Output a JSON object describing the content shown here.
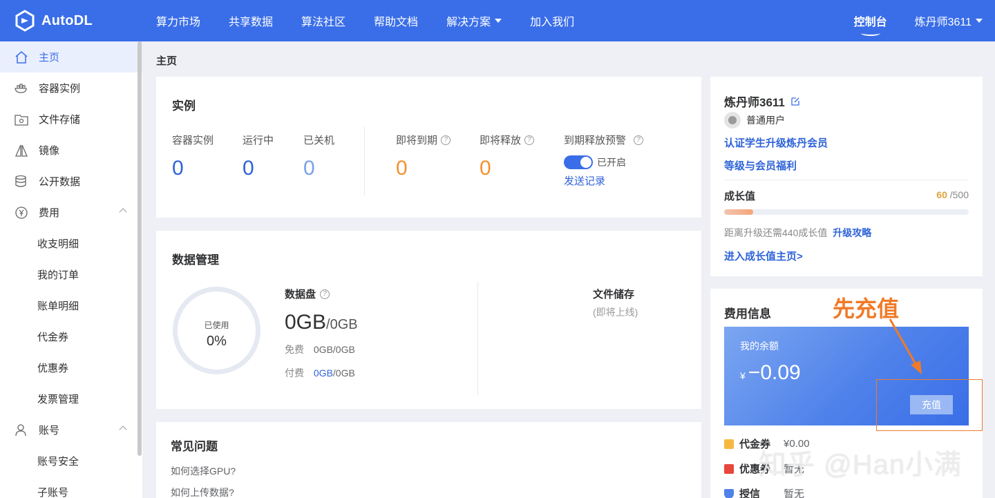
{
  "header": {
    "brand": "AutoDL",
    "nav": [
      {
        "label": "算力市场"
      },
      {
        "label": "共享数据"
      },
      {
        "label": "算法社区"
      },
      {
        "label": "帮助文档"
      },
      {
        "label": "解决方案",
        "dropdown": true
      },
      {
        "label": "加入我们"
      }
    ],
    "console": "控制台",
    "user": "炼丹师3611"
  },
  "sidebar": {
    "items": [
      {
        "label": "主页",
        "icon": "home-icon",
        "active": true
      },
      {
        "label": "容器实例",
        "icon": "container-icon"
      },
      {
        "label": "文件存储",
        "icon": "folder-icon"
      },
      {
        "label": "镜像",
        "icon": "image-icon"
      },
      {
        "label": "公开数据",
        "icon": "database-icon"
      },
      {
        "label": "费用",
        "icon": "yuan-icon",
        "expanded": true
      },
      {
        "label": "收支明细",
        "sub": true
      },
      {
        "label": "我的订单",
        "sub": true
      },
      {
        "label": "账单明细",
        "sub": true
      },
      {
        "label": "代金券",
        "sub": true
      },
      {
        "label": "优惠券",
        "sub": true
      },
      {
        "label": "发票管理",
        "sub": true
      },
      {
        "label": "账号",
        "icon": "user-icon",
        "expanded": true
      },
      {
        "label": "账号安全",
        "sub": true
      },
      {
        "label": "子账号",
        "sub": true
      }
    ]
  },
  "breadcrumb": "主页",
  "instances": {
    "title": "实例",
    "stats": [
      {
        "label": "容器实例",
        "value": "0",
        "color": "#2f63d8"
      },
      {
        "label": "运行中",
        "value": "0",
        "color": "#2f63d8"
      },
      {
        "label": "已关机",
        "value": "0",
        "color": "#7aa0e8"
      },
      {
        "label": "即将到期",
        "value": "0",
        "color": "#f5902f"
      },
      {
        "label": "即将释放",
        "value": "0",
        "color": "#f5902f"
      }
    ],
    "alert_label": "到期释放预警",
    "alert_state": "已开启",
    "send_log": "发送记录"
  },
  "data_mgmt": {
    "title": "数据管理",
    "ring_label": "已使用",
    "ring_value": "0%",
    "disk_label": "数据盘",
    "disk_used": "0GB",
    "disk_total": "/0GB",
    "free_label": "免费",
    "free_value": "0GB/0GB",
    "paid_label": "付费",
    "paid_used": "0GB",
    "paid_total": "/0GB",
    "file_title": "文件储存",
    "file_note": "(即将上线)"
  },
  "faq": {
    "title": "常见问题",
    "items": [
      "如何选择GPU?",
      "如何上传数据?"
    ]
  },
  "profile": {
    "name": "炼丹师3611",
    "level": "普通用户",
    "student_link": "认证学生升级炼丹会员",
    "benefits_link": "等级与会员福利",
    "growth_label": "成长值",
    "growth_value": "60",
    "growth_max": "/500",
    "growth_fraction": 0.12,
    "upgrade_note": "距离升级还需440成长值",
    "upgrade_link": "升级攻略",
    "growth_home": "进入成长值主页>"
  },
  "billing": {
    "title": "费用信息",
    "balance_label": "我的余额",
    "currency": "¥",
    "balance": "−0.09",
    "recharge": "充值",
    "rows": [
      {
        "label": "代金券",
        "value": "¥0.00",
        "color": "#f5b942"
      },
      {
        "label": "优惠券",
        "value": "暂无",
        "color": "#e8453c"
      },
      {
        "label": "授信",
        "value": "暂无",
        "color": "#4f82ea"
      }
    ]
  },
  "annotation": {
    "text": "先充值",
    "color": "#f07a27"
  },
  "watermark": "知乎 @Han小满"
}
